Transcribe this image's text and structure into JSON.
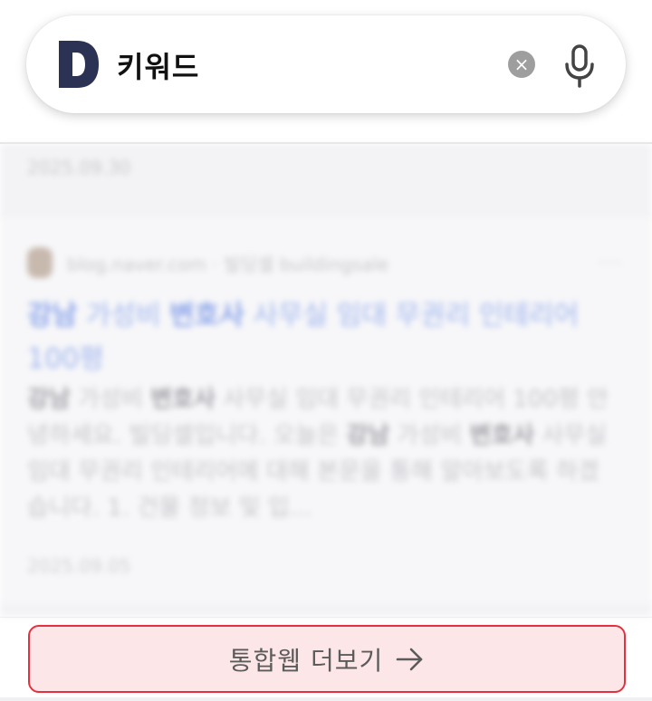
{
  "search": {
    "logo_letter": "D",
    "query": "키워드",
    "clear_icon": "close-icon",
    "mic_icon": "mic-icon",
    "clear_glyph": "×"
  },
  "results": {
    "previous_date": "2025.09.30",
    "item": {
      "source": "blog.naver.com · 빌딩셀 buildingsale",
      "more": "···",
      "title_prefix": "강남",
      "title_mid1": " 가성비 ",
      "title_bold": "변호사",
      "title_rest": " 사무실 임대 무권리 인테리어 100평",
      "desc_bold1": "강남",
      "desc_part1": " 가성비 ",
      "desc_bold2": "변호사",
      "desc_part2": " 사무실 임대 무권리 인테리어 100평 안녕하세요. 빌딩셀입니다. 오늘은 ",
      "desc_bold3": "강남",
      "desc_part3": " 가성비 ",
      "desc_bold4": "변호사",
      "desc_part4": " 사무실 임대 무권리 인테리어에 대해 본문을 통해 알아보도록 하겠습니다. 1. 건물 정보 및 입...",
      "date": "2025.09.05"
    }
  },
  "more_button": {
    "label": "통합웹 더보기",
    "arrow_icon": "arrow-right-icon",
    "border_color": "#e5303f",
    "bg_color": "#fde6e7"
  }
}
